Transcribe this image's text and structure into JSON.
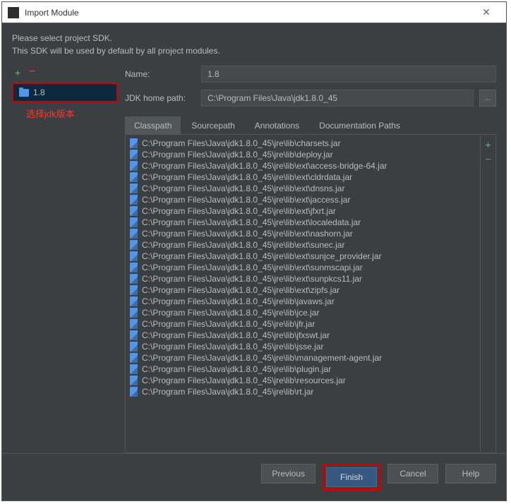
{
  "window": {
    "title": "Import Module"
  },
  "instructions": {
    "line1": "Please select project SDK.",
    "line2": "This SDK will be used by default by all project modules."
  },
  "sidebar": {
    "sdk_label": "1.8",
    "annotation": "选择jdk版本"
  },
  "form": {
    "name_label": "Name:",
    "name_value": "1.8",
    "home_label": "JDK home path:",
    "home_value": "C:\\Program Files\\Java\\jdk1.8.0_45",
    "browse_label": "..."
  },
  "tabs": [
    "Classpath",
    "Sourcepath",
    "Annotations",
    "Documentation Paths"
  ],
  "files": [
    "C:\\Program Files\\Java\\jdk1.8.0_45\\jre\\lib\\charsets.jar",
    "C:\\Program Files\\Java\\jdk1.8.0_45\\jre\\lib\\deploy.jar",
    "C:\\Program Files\\Java\\jdk1.8.0_45\\jre\\lib\\ext\\access-bridge-64.jar",
    "C:\\Program Files\\Java\\jdk1.8.0_45\\jre\\lib\\ext\\cldrdata.jar",
    "C:\\Program Files\\Java\\jdk1.8.0_45\\jre\\lib\\ext\\dnsns.jar",
    "C:\\Program Files\\Java\\jdk1.8.0_45\\jre\\lib\\ext\\jaccess.jar",
    "C:\\Program Files\\Java\\jdk1.8.0_45\\jre\\lib\\ext\\jfxrt.jar",
    "C:\\Program Files\\Java\\jdk1.8.0_45\\jre\\lib\\ext\\localedata.jar",
    "C:\\Program Files\\Java\\jdk1.8.0_45\\jre\\lib\\ext\\nashorn.jar",
    "C:\\Program Files\\Java\\jdk1.8.0_45\\jre\\lib\\ext\\sunec.jar",
    "C:\\Program Files\\Java\\jdk1.8.0_45\\jre\\lib\\ext\\sunjce_provider.jar",
    "C:\\Program Files\\Java\\jdk1.8.0_45\\jre\\lib\\ext\\sunmscapi.jar",
    "C:\\Program Files\\Java\\jdk1.8.0_45\\jre\\lib\\ext\\sunpkcs11.jar",
    "C:\\Program Files\\Java\\jdk1.8.0_45\\jre\\lib\\ext\\zipfs.jar",
    "C:\\Program Files\\Java\\jdk1.8.0_45\\jre\\lib\\javaws.jar",
    "C:\\Program Files\\Java\\jdk1.8.0_45\\jre\\lib\\jce.jar",
    "C:\\Program Files\\Java\\jdk1.8.0_45\\jre\\lib\\jfr.jar",
    "C:\\Program Files\\Java\\jdk1.8.0_45\\jre\\lib\\jfxswt.jar",
    "C:\\Program Files\\Java\\jdk1.8.0_45\\jre\\lib\\jsse.jar",
    "C:\\Program Files\\Java\\jdk1.8.0_45\\jre\\lib\\management-agent.jar",
    "C:\\Program Files\\Java\\jdk1.8.0_45\\jre\\lib\\plugin.jar",
    "C:\\Program Files\\Java\\jdk1.8.0_45\\jre\\lib\\resources.jar",
    "C:\\Program Files\\Java\\jdk1.8.0_45\\jre\\lib\\rt.jar"
  ],
  "footer": {
    "previous": "Previous",
    "finish": "Finish",
    "cancel": "Cancel",
    "help": "Help"
  }
}
